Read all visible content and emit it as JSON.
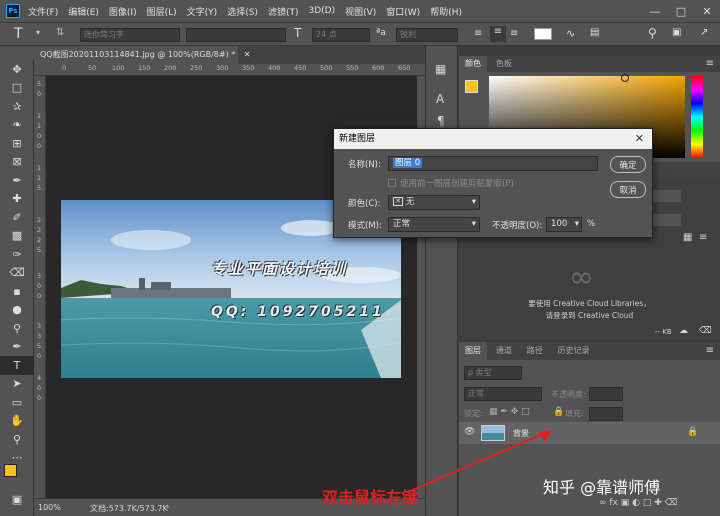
{
  "menubar": {
    "logo": "Ps",
    "items": [
      "文件(F)",
      "编辑(E)",
      "图像(I)",
      "图层(L)",
      "文字(Y)",
      "选择(S)",
      "滤镜(T)",
      "3D(D)",
      "视图(V)",
      "窗口(W)",
      "帮助(H)"
    ]
  },
  "options_bar": {
    "font_placeholder": "迷你简习字",
    "size_value": "24 点",
    "aa_label": "a",
    "aa_value": "锐利"
  },
  "document": {
    "tab_title": "QQ截图20201103114841.jpg @ 100%(RGB/8#) *",
    "ruler_h_ticks": [
      "0",
      "50",
      "100",
      "150",
      "200",
      "250",
      "300",
      "350",
      "400",
      "450",
      "500",
      "550",
      "600",
      "650"
    ],
    "ruler_v_ticks": [
      "5",
      "0",
      "1",
      "1",
      "0",
      "0",
      "1",
      "1",
      "5",
      "2",
      "2",
      "2",
      "5",
      "3",
      "0",
      "0",
      "3",
      "3",
      "5",
      "0",
      "4",
      "0",
      "0"
    ],
    "image_text_line1": "专业平面设计培训",
    "image_text_line2": "QQ: 1092705211",
    "zoom": "100%",
    "doc_size": "文档:573.7K/573.7K"
  },
  "dialog": {
    "title": "新建图层",
    "name_label": "名称(N):",
    "name_value": "图层 0",
    "clip_label": "使用前一图层创建剪贴蒙版(P)",
    "color_label": "颜色(C):",
    "color_value": "无",
    "mode_label": "模式(M):",
    "mode_value": "正常",
    "opacity_label": "不透明度(O):",
    "opacity_value": "100",
    "opacity_unit": "%",
    "ok": "确定",
    "cancel": "取消"
  },
  "color_panel": {
    "tabs": [
      "颜色",
      "色板"
    ],
    "accent": "#f2c31a"
  },
  "libraries": {
    "message_line1": "要使用 Creative Cloud Libraries，",
    "message_line2": "请登录到 Creative Cloud",
    "size": "-- KB"
  },
  "layers_panel": {
    "tabs": [
      "图层",
      "通道",
      "路径",
      "历史记录"
    ],
    "filter_label": "ρ 类型",
    "blend_mode": "正常",
    "opacity_label": "不透明度:",
    "lock_label": "锁定:",
    "fill_label": "填充:",
    "layer_name": "背景"
  },
  "annotation": "双击鼠标左键",
  "watermark": "知乎 @靠谱师傅"
}
